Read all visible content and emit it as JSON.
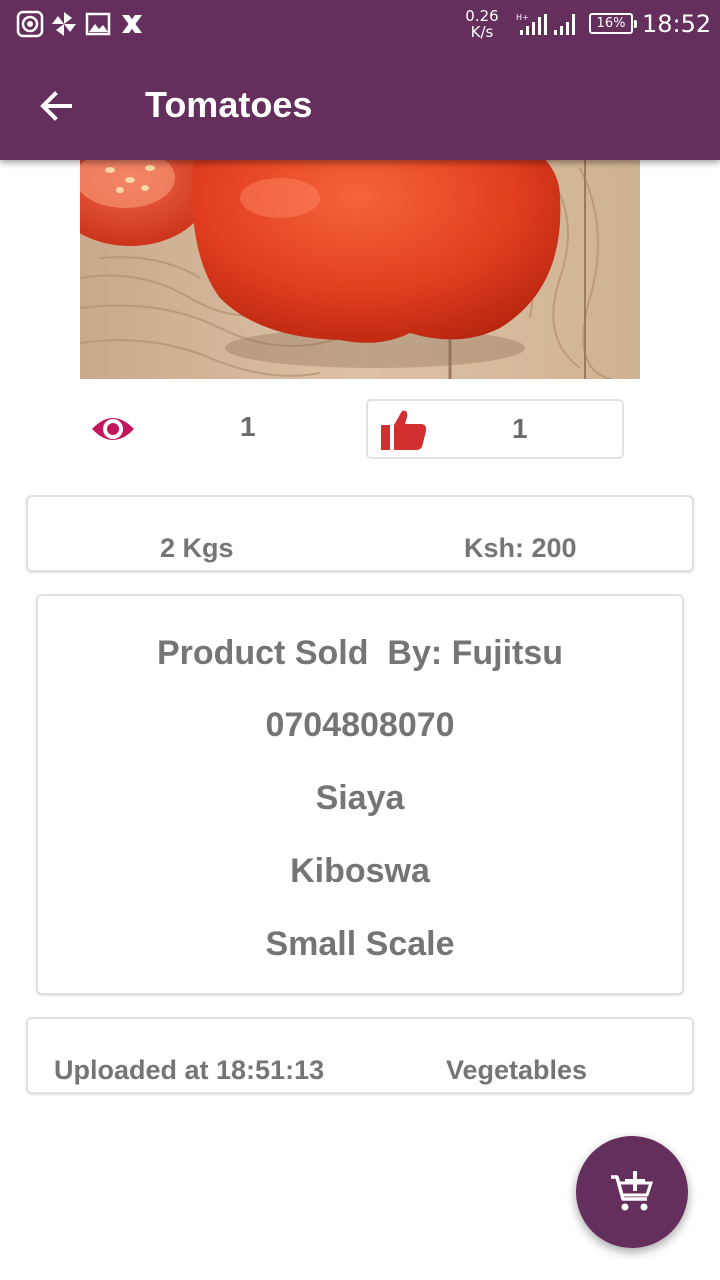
{
  "status_bar": {
    "network_speed_value": "0.26",
    "network_speed_unit": "K/s",
    "battery": "16%",
    "time": "18:52",
    "icons": [
      "screen-record-icon",
      "pinwheel-icon",
      "image-icon",
      "x-app-icon",
      "signal-icon",
      "battery-icon"
    ]
  },
  "app_bar": {
    "title": "Tomatoes",
    "back_icon": "arrow-left-icon"
  },
  "product": {
    "image": "tomato-photo",
    "views": "1",
    "likes": "1",
    "quantity": "2 Kgs",
    "price": "Ksh: 200"
  },
  "seller": {
    "sold_by": "Product Sold  By: Fujitsu",
    "phone": "0704808070",
    "county": "Siaya",
    "town": "Kiboswa",
    "scale": "Small Scale"
  },
  "meta": {
    "uploaded": "Uploaded at 18:51:13",
    "category": "Vegetables"
  },
  "fab": {
    "icon": "add-to-cart-icon"
  },
  "colors": {
    "primary": "#652f5d",
    "accent_red": "#c2185b",
    "thumb_red": "#d32f2f",
    "text_grey": "#757575"
  }
}
